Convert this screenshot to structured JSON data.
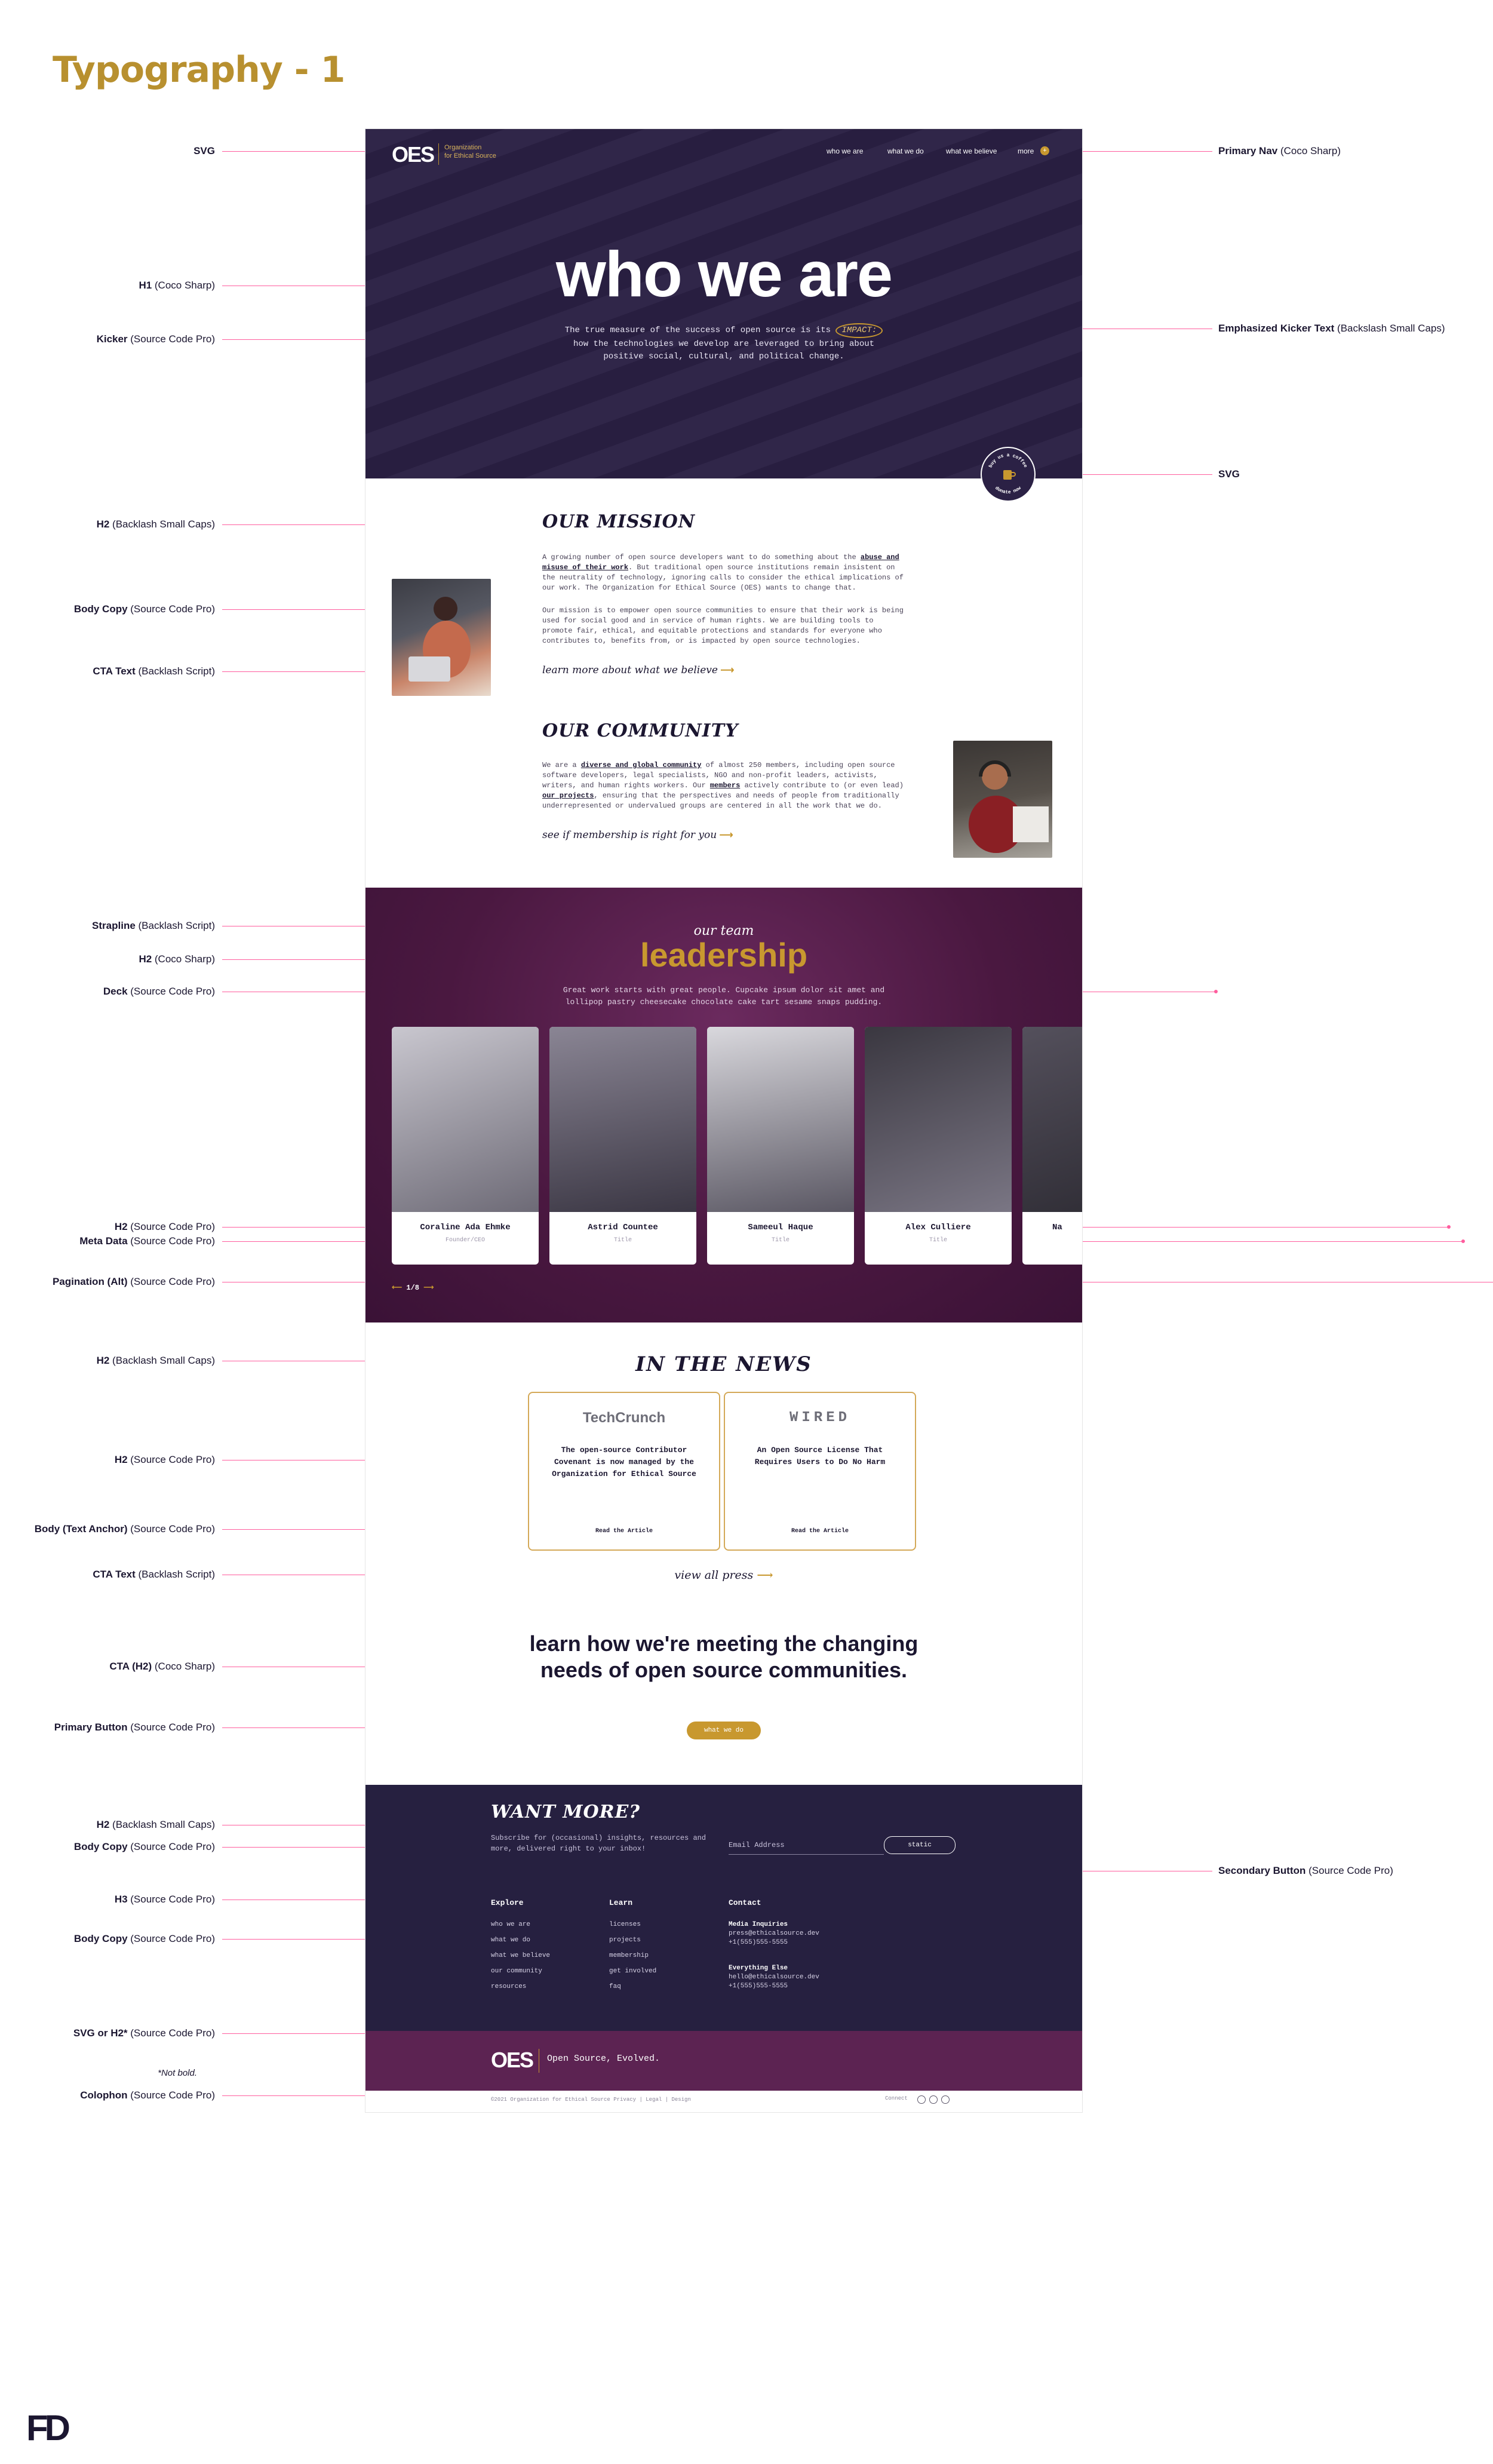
{
  "page": {
    "title": "Typography - 1"
  },
  "colors": {
    "gold": "#c8982f",
    "navy": "#2b2145",
    "plum": "#4a1840",
    "footer": "#262040",
    "annotation_line": "#ff5d9e"
  },
  "annotations": {
    "left": [
      {
        "bold": "SVG",
        "note": ""
      },
      {
        "bold": "H1",
        "note": " (Coco Sharp)"
      },
      {
        "bold": "Kicker",
        "note": " (Source Code Pro)"
      },
      {
        "bold": "H2",
        "note": " (Backlash Small Caps)"
      },
      {
        "bold": "Body Copy",
        "note": " (Source Code Pro)"
      },
      {
        "bold": "CTA Text",
        "note": " (Backlash Script)"
      },
      {
        "bold": "Strapline",
        "note": " (Backlash Script)"
      },
      {
        "bold": "H2",
        "note": " (Coco Sharp)"
      },
      {
        "bold": "Deck",
        "note": " (Source Code Pro)"
      },
      {
        "bold": "H2",
        "note": " (Source Code Pro)"
      },
      {
        "bold": "Meta Data",
        "note": " (Source Code Pro)"
      },
      {
        "bold": "Pagination (Alt)",
        "note": " (Source Code Pro)"
      },
      {
        "bold": "H2",
        "note": " (Backlash Small Caps)"
      },
      {
        "bold": "H2",
        "note": " (Source Code Pro)"
      },
      {
        "bold": "Body (Text Anchor)",
        "note": " (Source Code Pro)"
      },
      {
        "bold": "CTA Text",
        "note": " (Backlash Script)"
      },
      {
        "bold": "CTA (H2)",
        "note": " (Coco Sharp)"
      },
      {
        "bold": "Primary Button",
        "note": " (Source Code Pro)"
      },
      {
        "bold": "H2",
        "note": " (Backlash Small Caps)"
      },
      {
        "bold": "Body Copy",
        "note": " (Source Code Pro)"
      },
      {
        "bold": "H3",
        "note": " (Source Code Pro)"
      },
      {
        "bold": "Body Copy",
        "note": " (Source Code Pro)"
      },
      {
        "bold": "SVG or H2*",
        "note": " (Source Code Pro)"
      },
      {
        "bold": "Colophon",
        "note": " (Source Code Pro)"
      }
    ],
    "not_bold": "*Not bold.",
    "right": [
      {
        "bold": "Primary Nav",
        "note": " (Coco Sharp)"
      },
      {
        "bold": "Emphasized Kicker Text",
        "note": " (Backslash Small Caps)"
      },
      {
        "bold": "SVG",
        "note": ""
      },
      {
        "bold": "Secondary Button",
        "note": " (Source Code Pro)"
      }
    ]
  },
  "header": {
    "logo": "OES",
    "logo_line1": "Organization",
    "logo_line2": "for Ethical Source",
    "nav": [
      "who we are",
      "what we do",
      "what we believe",
      "more"
    ],
    "nav_more_icon": "+"
  },
  "hero": {
    "h1": "who we are",
    "kicker_before": "The true measure of the success of open source is its",
    "kicker_emph": "IMPACT:",
    "kicker_after": "how the technologies we develop are leveraged to bring about positive social, cultural, and political change.",
    "badge_top": "buy us a coffee",
    "badge_bottom": "donate now"
  },
  "mission": {
    "h2": "OUR MISSION",
    "p1_a": "A growing number of open source developers want to do something about the",
    "p1_link": "abuse and misuse of their work",
    "p1_b": ". But traditional open source institutions remain insistent on the neutrality of technology, ignoring calls to consider the ethical implications of our work. The Organization for Ethical Source (OES) wants to change that.",
    "p2": "Our mission is to empower open source communities to ensure that their work is being used for social good and in service of human rights. We are building tools to promote fair, ethical, and equitable protections and standards for everyone who contributes to, benefits from, or is impacted by open source technologies.",
    "cta": "learn more about what we believe"
  },
  "community": {
    "h2": "OUR COMMUNITY",
    "p_a": "We are a",
    "p_link1": "diverse and global community",
    "p_b": "of almost 250 members, including open source software developers, legal specialists, NGO and non-profit leaders, activists, writers, and human rights workers. Our",
    "p_link2": "members",
    "p_c": "actively contribute to (or even lead)",
    "p_link3": "our projects",
    "p_d": ", ensuring that the perspectives and needs of people from traditionally underrepresented or undervalued groups are centered in all the work that we do.",
    "cta": "see if membership is right for you"
  },
  "leadership": {
    "strapline": "our team",
    "h2": "leadership",
    "deck": "Great work starts with great people. Cupcake ipsum dolor sit amet and lollipop pastry cheesecake chocolate cake tart sesame snaps pudding.",
    "people": [
      {
        "name": "Coraline Ada Ehmke",
        "meta": "Founder/CEO"
      },
      {
        "name": "Astrid Countee",
        "meta": "Title"
      },
      {
        "name": "Sameeul Haque",
        "meta": "Title"
      },
      {
        "name": "Alex Culliere",
        "meta": "Title"
      },
      {
        "name": "Na",
        "meta": ""
      }
    ],
    "pager": "1/8"
  },
  "news": {
    "h2": "IN THE NEWS",
    "items": [
      {
        "source": "TechCrunch",
        "title": "The open-source Contributor Covenant is now managed by the Organization for Ethical Source",
        "link": "Read the Article"
      },
      {
        "source": "WIRED",
        "title": "An Open Source License That Requires Users to Do No Harm",
        "link": "Read the Article"
      }
    ],
    "cta": "view all press"
  },
  "cta": {
    "h2": "learn how we're meeting the changing needs of open source communities.",
    "button": "what we do"
  },
  "footer": {
    "h2": "WANT MORE?",
    "subtitle": "Subscribe for (occasional) insights, resources and more, delivered right to your inbox!",
    "email_placeholder": "Email Address",
    "button": "static",
    "columns": [
      {
        "heading": "Explore",
        "links": [
          "who we are",
          "what we do",
          "what we believe",
          "our community",
          "resources"
        ]
      },
      {
        "heading": "Learn",
        "links": [
          "licenses",
          "projects",
          "membership",
          "get involved",
          "faq"
        ]
      },
      {
        "heading": "Contact",
        "links": [
          "Media Inquiries",
          "press@ethicalsource.dev",
          "+1(555)555-5555",
          "Everything Else",
          "hello@ethicalsource.dev",
          "+1(555)555-5555"
        ]
      }
    ],
    "band_logo": "OES",
    "band_text": "Open Source, Evolved.",
    "colophon": "©2021 Organization for Ethical Source   Privacy | Legal | Design",
    "connect": "Connect"
  },
  "brand_mark": "FD"
}
